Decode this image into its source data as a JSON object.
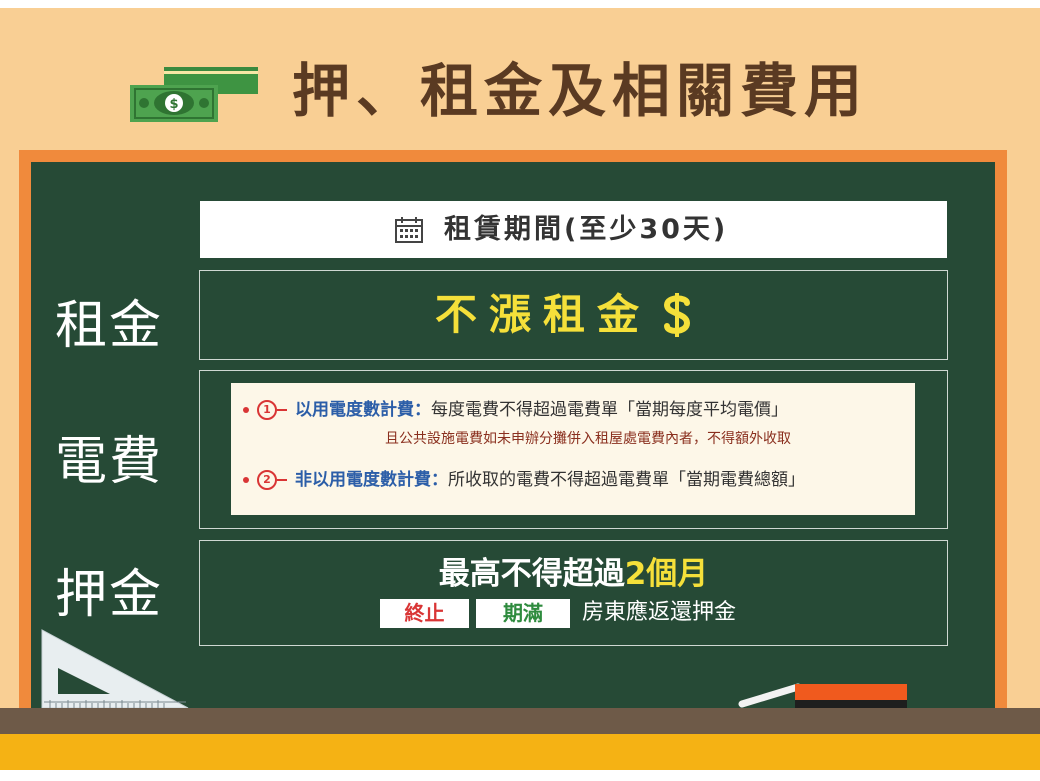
{
  "title": {
    "icon": "money-bills-icon",
    "text": "押、租金及相關費用"
  },
  "colors": {
    "wall": "#f9cf94",
    "frame": "#f08a3c",
    "board": "#264a36",
    "title_text": "#5a3a22",
    "highlight_yellow": "#f5e03a",
    "tag_red": "#d93535",
    "tag_green": "#2e8b3e",
    "blue_heading": "#2c5ea8"
  },
  "period": {
    "icon": "calendar-icon",
    "text": "租賃期間(至少30天)"
  },
  "rent": {
    "label": "租金",
    "text": "不漲租金",
    "icon": "dollar-icon"
  },
  "electricity": {
    "label": "電費",
    "items": [
      {
        "number": "1",
        "heading": "以用電度數計費：",
        "text": "每度電費不得超過電費單「當期每度平均電價」",
        "note": "且公共設施電費如未申辦分攤併入租屋處電費內者，不得額外收取"
      },
      {
        "number": "2",
        "heading": "非以用電度數計費：",
        "text": "所收取的電費不得超過電費單「當期電費總額」"
      }
    ]
  },
  "deposit": {
    "label": "押金",
    "main_prefix": "最高不得超過",
    "main_highlight": "2個月",
    "tag_end": "終止",
    "tag_expire": "期滿",
    "sub_text": "房東應返還押金"
  },
  "decor": {
    "triangle_icon": "set-square-ruler-icon",
    "chalk_icon": "chalk-icon",
    "eraser_icon": "eraser-icon"
  }
}
